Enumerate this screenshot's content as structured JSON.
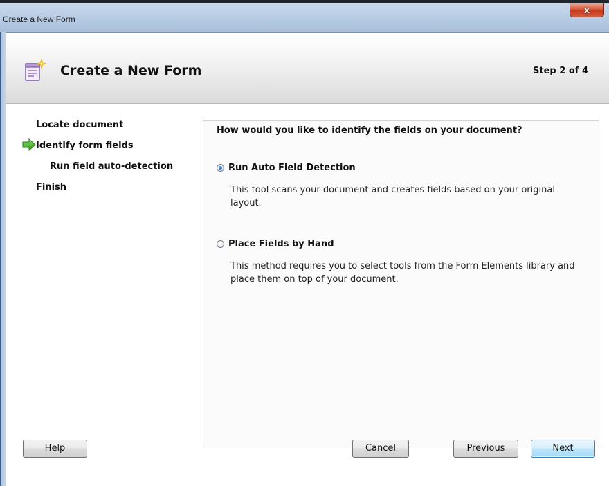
{
  "window": {
    "title": "Create a New Form",
    "close_label": "x"
  },
  "header": {
    "title": "Create a New Form",
    "step_indicator": "Step 2 of 4",
    "icon": "form-sparkle-icon"
  },
  "steps": {
    "current_marker_icon": "green-arrow-icon",
    "items": [
      {
        "label": "Locate document",
        "current": false,
        "substep": false
      },
      {
        "label": "Identify form fields",
        "current": true,
        "substep": false
      },
      {
        "label": "Run field auto-detection",
        "current": false,
        "substep": true
      },
      {
        "label": "Finish",
        "current": false,
        "substep": false
      }
    ]
  },
  "panel": {
    "question": "How would you like to identify the fields on your document?",
    "options": [
      {
        "label": "Run Auto Field Detection",
        "selected": true,
        "description": "This tool scans your document and creates fields based on your original layout."
      },
      {
        "label": "Place Fields by Hand",
        "selected": false,
        "description": "This method requires you to select tools from the Form Elements library and place them on top of your document."
      }
    ]
  },
  "buttons": {
    "help": "Help",
    "cancel": "Cancel",
    "previous": "Previous",
    "next": "Next"
  },
  "colors": {
    "titlebar": "#b9cde4",
    "close_button": "#c43a1c",
    "arrow_green": "#3aa32c",
    "default_button_border": "#3c7fb1"
  }
}
